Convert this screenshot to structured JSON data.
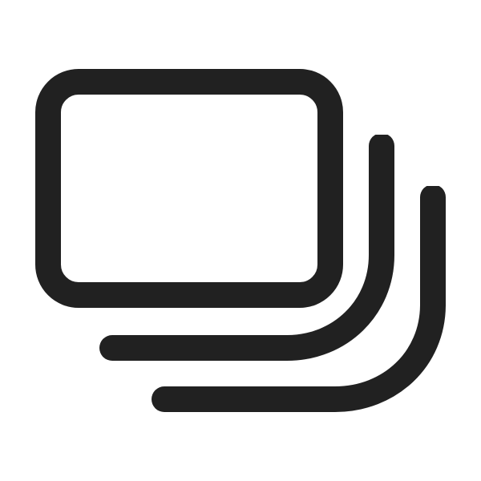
{
  "icon": {
    "name": "stacked-cards-icon",
    "stroke_color": "#212121",
    "background_color": "#ffffff"
  }
}
